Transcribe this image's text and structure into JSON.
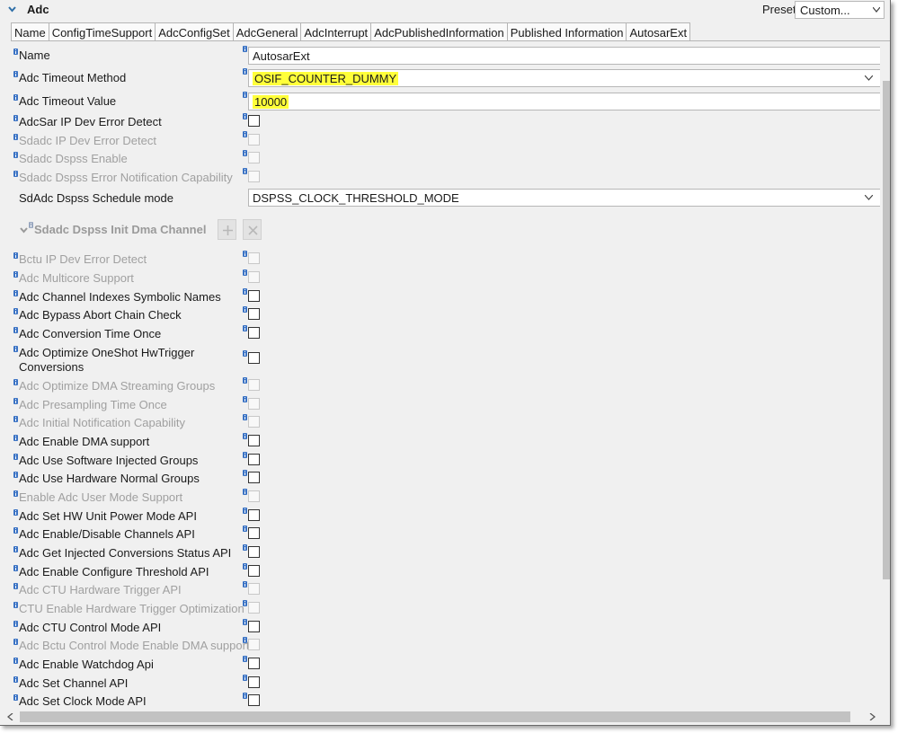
{
  "header": {
    "title": "Adc",
    "preset_label": "Preset",
    "preset_value": "Custom..."
  },
  "tabs": [
    "Name",
    "ConfigTimeSupport",
    "AdcConfigSet",
    "AdcGeneral",
    "AdcInterrupt",
    "AdcPublishedInformation",
    "Published Information",
    "AutosarExt"
  ],
  "fields": {
    "name": {
      "label": "Name",
      "value": "AutosarExt"
    },
    "timeout_method": {
      "label": "Adc Timeout Method",
      "value": "OSIF_COUNTER_DUMMY"
    },
    "timeout_value": {
      "label": "Adc Timeout Value",
      "value": "10000"
    },
    "schedule_mode": {
      "label": "SdAdc Dspss Schedule mode",
      "value": "DSPSS_CLOCK_THRESHOLD_MODE"
    }
  },
  "subgroup": {
    "label": "Sdadc Dspss Init Dma Channel"
  },
  "checkboxes": {
    "adcsar_ip_dev_error": {
      "label": "AdcSar IP Dev Error Detect",
      "enabled": true,
      "checked": false
    },
    "sdadc_ip_dev_error": {
      "label": "Sdadc IP Dev Error Detect",
      "enabled": false,
      "checked": false
    },
    "sdadc_dspss_enable": {
      "label": "Sdadc Dspss Enable",
      "enabled": false,
      "checked": false
    },
    "sdadc_dspss_error_notif": {
      "label": "Sdadc Dspss Error Notification Capability",
      "enabled": false,
      "checked": false
    },
    "bctu_ip_dev_error": {
      "label": "Bctu IP Dev Error Detect",
      "enabled": false,
      "checked": false
    },
    "multicore_support": {
      "label": "Adc Multicore Support",
      "enabled": false,
      "checked": false
    },
    "channel_indexes_symbolic": {
      "label": "Adc Channel Indexes Symbolic Names",
      "enabled": true,
      "checked": false
    },
    "bypass_abort_chain": {
      "label": "Adc Bypass Abort Chain Check",
      "enabled": true,
      "checked": false
    },
    "conversion_time_once": {
      "label": "Adc Conversion Time Once",
      "enabled": true,
      "checked": false
    },
    "optimize_oneshot_line1": {
      "label": "Adc Optimize OneShot HwTrigger",
      "enabled": true,
      "checked": false
    },
    "optimize_oneshot_line2": {
      "label": "Conversions"
    },
    "optimize_dma_streaming": {
      "label": "Adc Optimize DMA Streaming Groups",
      "enabled": false,
      "checked": false
    },
    "presampling_time_once": {
      "label": "Adc Presampling Time Once",
      "enabled": false,
      "checked": false
    },
    "initial_notif_capability": {
      "label": "Adc Initial Notification Capability",
      "enabled": false,
      "checked": false
    },
    "enable_dma_support": {
      "label": "Adc Enable DMA support",
      "enabled": true,
      "checked": false
    },
    "use_sw_injected_groups": {
      "label": "Adc Use Software Injected Groups",
      "enabled": true,
      "checked": false
    },
    "use_hw_normal_groups": {
      "label": "Adc Use Hardware Normal Groups",
      "enabled": true,
      "checked": false
    },
    "enable_user_mode": {
      "label": "Enable Adc User Mode Support",
      "enabled": false,
      "checked": false
    },
    "set_hw_unit_power": {
      "label": "Adc Set HW Unit Power Mode API",
      "enabled": true,
      "checked": false
    },
    "enable_disable_channels": {
      "label": "Adc Enable/Disable Channels API",
      "enabled": true,
      "checked": false
    },
    "get_injected_status": {
      "label": "Adc Get Injected Conversions Status API",
      "enabled": true,
      "checked": false
    },
    "enable_configure_threshold": {
      "label": "Adc Enable Configure Threshold API",
      "enabled": true,
      "checked": false
    },
    "ctu_hw_trigger_api": {
      "label": "Adc CTU Hardware Trigger API",
      "enabled": false,
      "checked": false
    },
    "ctu_enable_hw_trigger_opt": {
      "label": "CTU Enable Hardware Trigger Optimization",
      "enabled": false,
      "checked": false
    },
    "ctu_control_mode_api": {
      "label": "Adc CTU Control Mode API",
      "enabled": true,
      "checked": false
    },
    "bctu_control_mode_dma": {
      "label": "Adc Bctu Control Mode Enable DMA support",
      "enabled": false,
      "checked": false
    },
    "enable_watchdog_api": {
      "label": "Adc Enable Watchdog Api",
      "enabled": true,
      "checked": false
    },
    "set_channel_api": {
      "label": "Adc Set Channel API",
      "enabled": true,
      "checked": false
    },
    "set_clock_mode_api": {
      "label": "Adc Set Clock Mode API",
      "enabled": true,
      "checked": false
    }
  },
  "colors": {
    "highlight": "#ffff3a",
    "disabled_text": "#a0a0a0",
    "info_marker": "#3b73c4"
  }
}
